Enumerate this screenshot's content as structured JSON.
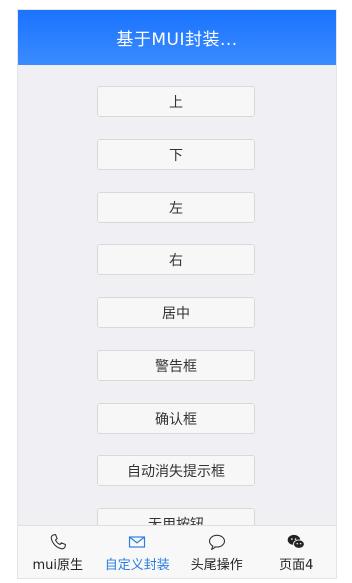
{
  "header": {
    "title": "基于MUI封装..."
  },
  "buttons": [
    {
      "label": "上"
    },
    {
      "label": "下"
    },
    {
      "label": "左"
    },
    {
      "label": "右"
    },
    {
      "label": "居中"
    },
    {
      "label": "警告框"
    },
    {
      "label": "确认框"
    },
    {
      "label": "自动消失提示框"
    },
    {
      "label": "无用按钮"
    }
  ],
  "tabbar": {
    "tabs": [
      {
        "label": "mui原生",
        "icon": "phone-icon"
      },
      {
        "label": "自定义封装",
        "icon": "mail-icon",
        "active": true
      },
      {
        "label": "头尾操作",
        "icon": "chat-bubble-icon"
      },
      {
        "label": "页面4",
        "icon": "wechat-icon"
      }
    ]
  },
  "colors": {
    "header": "#1a73ff",
    "active_tab": "#2a7de1",
    "background": "#efeff4"
  }
}
